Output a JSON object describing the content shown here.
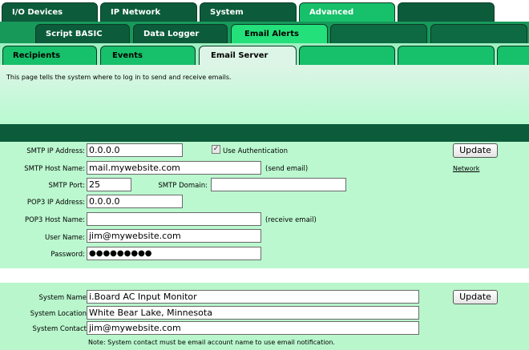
{
  "tabs": {
    "row1": [
      "I/O Devices",
      "IP Network",
      "System",
      "Advanced"
    ],
    "row2": [
      "Script BASIC",
      "Data Logger",
      "Email Alerts"
    ],
    "row3": [
      "Recipients",
      "Events",
      "Email Server"
    ]
  },
  "intro": "This page tells the system where to log in to send and receive emails.",
  "smtp": {
    "ip_label": "SMTP IP Address:",
    "ip_value": "0.0.0.0",
    "use_auth_label": "Use Authentication",
    "use_auth_checked": true,
    "host_label": "SMTP Host Name:",
    "host_value": "mail.mywebsite.com",
    "send_hint": "(send email)",
    "port_label": "SMTP Port:",
    "port_value": "25",
    "domain_label": "SMTP Domain:",
    "domain_value": ""
  },
  "pop3": {
    "ip_label": "POP3 IP Address:",
    "ip_value": "0.0.0.0",
    "host_label": "POP3 Host Name:",
    "host_value": "",
    "receive_hint": "(receive email)"
  },
  "account": {
    "user_label": "User Name:",
    "user_value": "jim@mywebsite.com",
    "password_label": "Password:",
    "password_value": "●●●●●●●●●"
  },
  "buttons": {
    "update": "Update"
  },
  "network_link": "Network",
  "system": {
    "name_label": "System Name",
    "name_value": "i.Board AC Input Monitor",
    "location_label": "System Location",
    "location_value": "White Bear Lake, Minnesota",
    "contact_label": "System Contact",
    "contact_value": "jim@mywebsite.com",
    "note": "Note: System contact must be email account name to use email notification."
  }
}
